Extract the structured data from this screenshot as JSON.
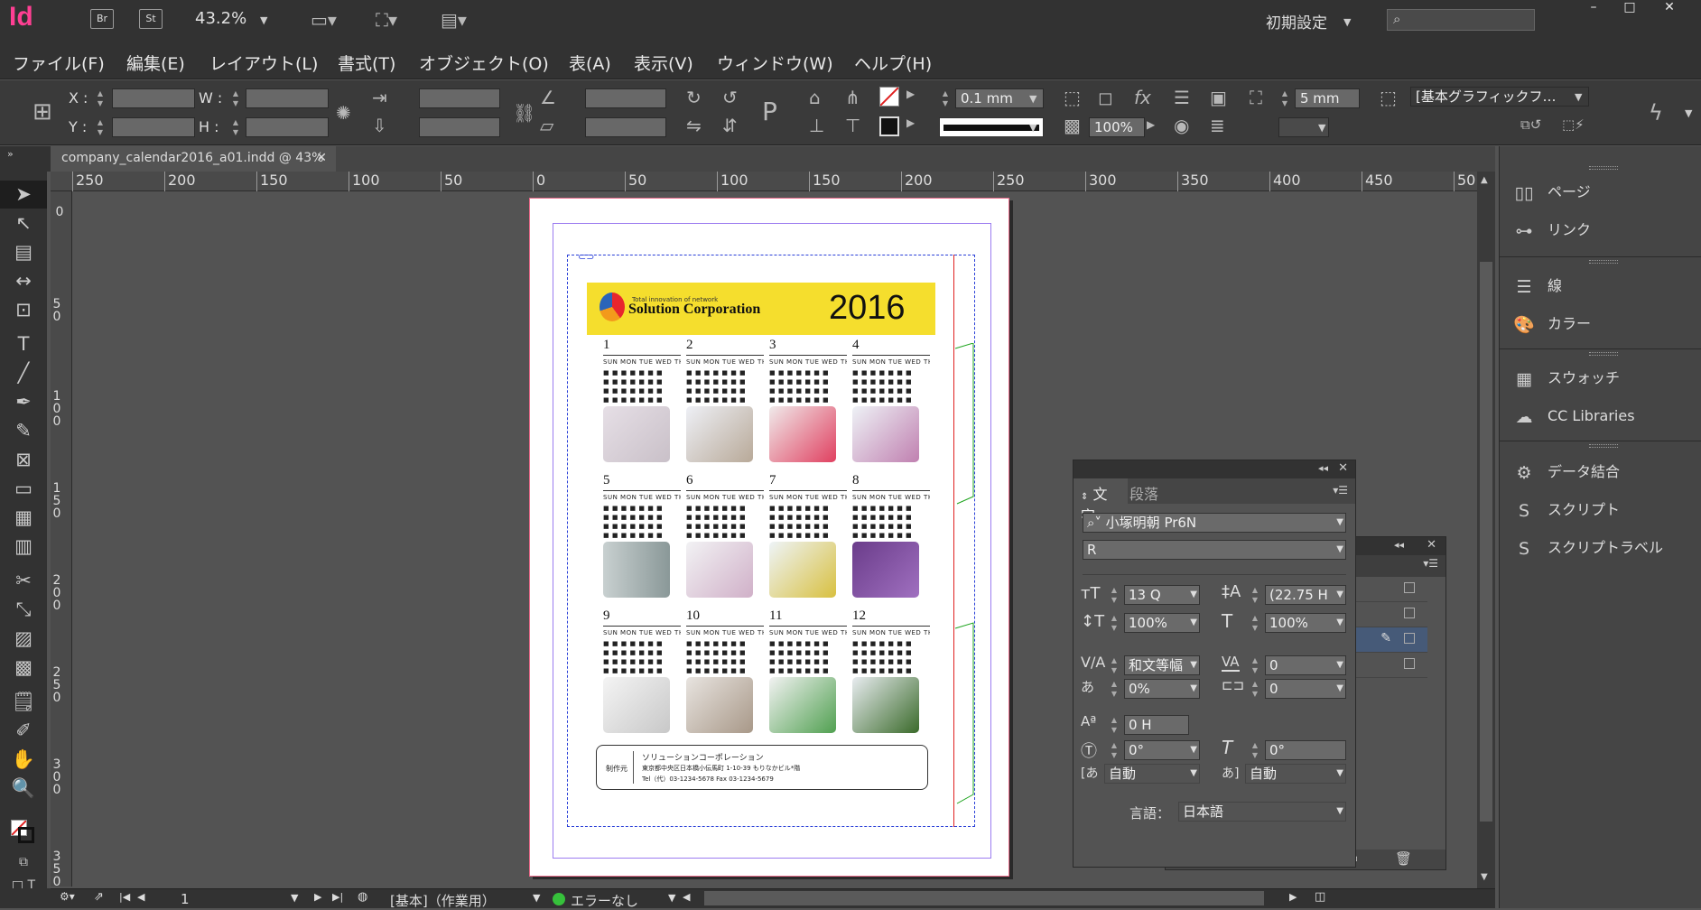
{
  "app": {
    "logo": "Id",
    "bridge": "Br",
    "stock": "St",
    "zoom": "43.2%",
    "workspace": "初期設定"
  },
  "window_controls": {
    "minimize": "–",
    "maximize": "□",
    "close": "✕"
  },
  "menu": [
    "ファイル(F)",
    "編集(E)",
    "レイアウト(L)",
    "書式(T)",
    "オブジェクト(O)",
    "表(A)",
    "表示(V)",
    "ウィンドウ(W)",
    "ヘルプ(H)"
  ],
  "control": {
    "x_label": "X :",
    "y_label": "Y :",
    "w_label": "W :",
    "h_label": "H :",
    "stroke_weight": "0.1 mm",
    "opacity": "100%",
    "offset": "5 mm",
    "object_style": "[基本グラフィックフ…"
  },
  "document_tab": {
    "title": "company_calendar2016_a01.indd @ 43%",
    "close": "✕"
  },
  "ruler_h": [
    "250",
    "200",
    "150",
    "100",
    "50",
    "0",
    "50",
    "100",
    "150",
    "200",
    "250",
    "300",
    "350",
    "400",
    "450",
    "50"
  ],
  "ruler_v": [
    "0",
    "50",
    "100",
    "150",
    "200",
    "250",
    "300",
    "350"
  ],
  "calendar": {
    "small_title": "Total innovation of network",
    "company": "Solution Corporation",
    "year": "2016",
    "months": [
      "1",
      "2",
      "3",
      "4",
      "5",
      "6",
      "7",
      "8",
      "9",
      "10",
      "11",
      "12"
    ],
    "weekdays": "SUN MON TUE WED THU FRI SAT",
    "footer_label": "制作元",
    "footer_company": "ソリューションコーポレーション",
    "footer_address": "東京都中央区日本橋小伝馬町 1-10-39 もりなかビル*階",
    "footer_tel": "Tel（代）03-1234-5678 Fax 03-1234-5679"
  },
  "panels": [
    {
      "icon": "pages-icon",
      "label": "ページ"
    },
    {
      "icon": "links-icon",
      "label": "リンク"
    },
    {
      "icon": "stroke-icon",
      "label": "線"
    },
    {
      "icon": "color-icon",
      "label": "カラー"
    },
    {
      "icon": "swatches-icon",
      "label": "スウォッチ"
    },
    {
      "icon": "cc-libraries-icon",
      "label": "CC Libraries"
    },
    {
      "icon": "data-merge-icon",
      "label": "データ結合"
    },
    {
      "icon": "scripts-icon",
      "label": "スクリプト"
    },
    {
      "icon": "script-label-icon",
      "label": "スクリプトラベル"
    }
  ],
  "character_panel": {
    "tab_character": "文字",
    "tab_paragraph": "段落",
    "font": "小塚明朝 Pr6N",
    "style": "R",
    "size": "13 Q",
    "leading": "(22.75 H",
    "vscale": "100%",
    "hscale": "100%",
    "kerning": "和文等幅",
    "tracking": "0",
    "tsume": "0%",
    "aki": "0",
    "baseline": "0 H",
    "rotate": "0°",
    "skew": "0°",
    "aki_before": "自動",
    "aki_after": "自動",
    "language_label": "言語：",
    "language": "日本語"
  },
  "status": {
    "page": "1",
    "master": "[基本]（作業用）",
    "preflight": "エラーなし"
  }
}
